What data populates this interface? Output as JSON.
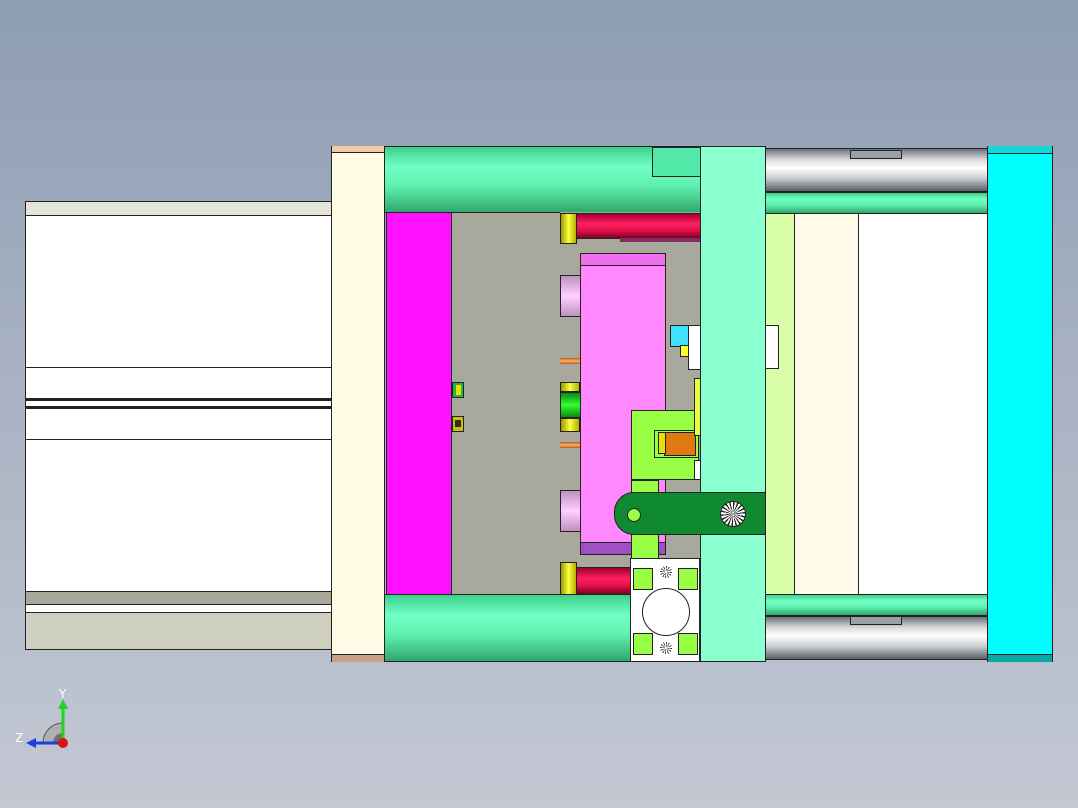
{
  "viewport": {
    "background_top": "#8d9db3",
    "background_bottom": "#c3c8d3"
  },
  "model": {
    "description_colors": {
      "nozzle_block": "#ffffff",
      "fixed_clamp_plate": "#fffbe8",
      "cavity_plate": "#ff10ff",
      "core_plate": "#a8a89c",
      "guide_pillars": "#6affc0",
      "mold_plate": "#8affd0",
      "ejector_retainer": "#ff88ff",
      "moving_plate": "#d8ffa8",
      "support_plate": "#fffbe8",
      "moving_clamp_plate": "#00ffff",
      "lifter": "#99ff44",
      "link_bar": "#108a30"
    }
  },
  "triad": {
    "y_label": "Y",
    "z_label": "Z",
    "y_color": "#1fd51f",
    "z_color": "#1a40e0",
    "x_color": "#e01010"
  }
}
